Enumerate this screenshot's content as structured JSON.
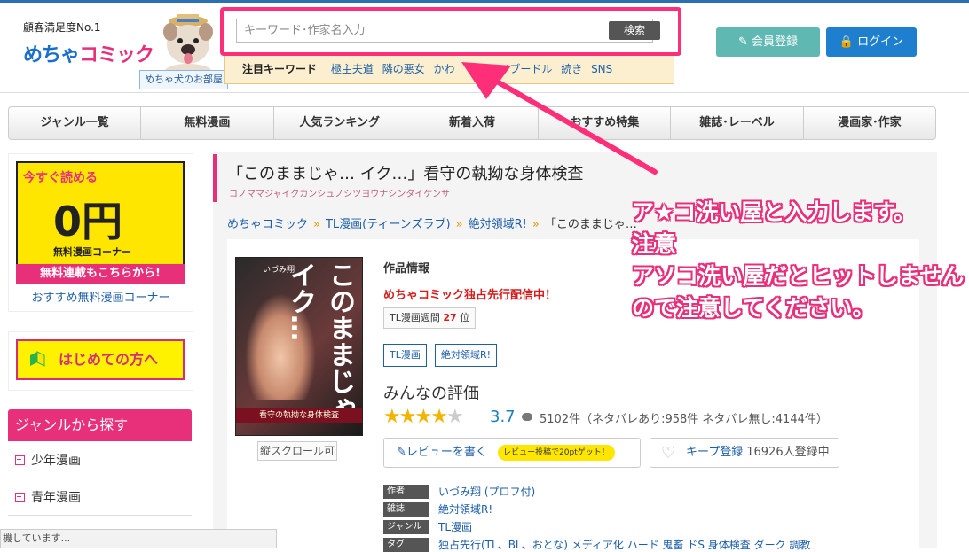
{
  "header": {
    "brand_sub": "顧客満足度No.1",
    "brand_logo_a": "めちゃ",
    "brand_logo_b": "コミック",
    "dog_label": "めちゃ犬のお部屋",
    "search": {
      "placeholder": "キーワード･作家名入力",
      "button": "検索"
    },
    "keywords": {
      "title": "注目キーワード",
      "items": [
        "極主夫道",
        "隣の悪女",
        "かわ",
        "イブードル",
        "続き",
        "SNS"
      ]
    },
    "register_button": "会員登録",
    "login_button": "ログイン"
  },
  "nav": [
    "ジャンル一覧",
    "無料漫画",
    "人気ランキング",
    "新着入荷",
    "おすすめ特集",
    "雑誌･レーベル",
    "漫画家･作家"
  ],
  "sidebar": {
    "free_banner": {
      "top": "今すぐ読める",
      "big": "0円",
      "sub": "無料漫画コーナー",
      "strip": "無料連載もこちらから!"
    },
    "free_link": "おすすめ無料漫画コーナー",
    "first_banner": "はじめての方へ",
    "genre_heading": "ジャンルから探す",
    "genres": [
      "少年漫画",
      "青年漫画"
    ]
  },
  "status_text": "機しています...",
  "main": {
    "title": "「このままじゃ… イク…」看守の執拗な身体検査",
    "kana": "コノママジャイクカンシュノシツヨウナシンタイケンサ",
    "breadcrumbs": [
      "めちゃコミック",
      "TL漫画(ティーンズラブ)",
      "絶対領域R!",
      "「このままじゃ…"
    ],
    "cover": {
      "title": "このままじゃ イク…",
      "author": "いづみ翔",
      "strip": "看守の執拗な身体検査"
    },
    "scroll_tag": "縦スクロール可",
    "info_heading": "作品情報",
    "exclusive": "めちゃコミック独占先行配信中！",
    "rank_prefix": "TL漫画週間",
    "rank_num": "27",
    "rank_suffix": "位",
    "tags": [
      "TL漫画",
      "絶対領域R!"
    ],
    "eval_title": "みんなの評価",
    "rating": 3.7,
    "score": "3.7",
    "review_count": "5102件（ネタバレあり:958件 ネタバレ無し:4144件）",
    "review_button": "レビューを書く",
    "review_badge": "レビュー投稿で20ptゲット！",
    "keep_button": "キープ登録",
    "keep_count": "16926人登録中",
    "meta": [
      {
        "label": "作者",
        "value": "いづみ翔 (プロフ付)"
      },
      {
        "label": "雑誌",
        "value": "絶対領域R!"
      },
      {
        "label": "ジャンル",
        "value": "TL漫画"
      },
      {
        "label": "タグ",
        "value": "独占先行(TL、BL、おとな) メディア化 ハード 鬼畜 ドS 身体検査 ダーク 調教"
      }
    ]
  },
  "annotation": {
    "line1": "ア★コ洗い屋と入力します。",
    "line2": "注意",
    "line3": "アソコ洗い屋だとヒットしません",
    "line4": "ので注意してください。"
  },
  "colors": {
    "accent_pink": "#e8307a",
    "link_blue": "#1d5ea8",
    "annotation_pink": "#ff2e79"
  }
}
